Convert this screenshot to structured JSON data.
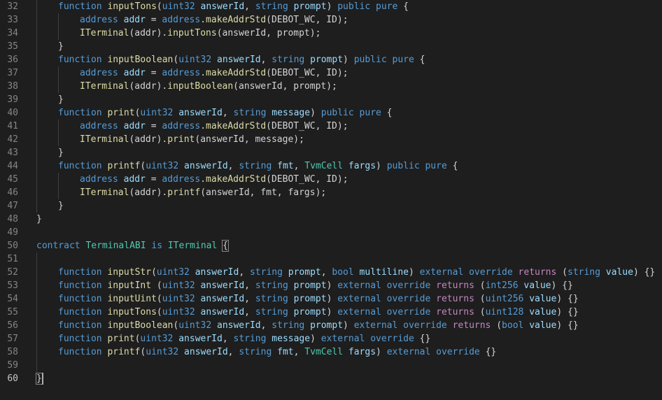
{
  "editor": {
    "lines": [
      {
        "n": "32",
        "indent": 1,
        "tokens": [
          [
            "kw",
            "function "
          ],
          [
            "fn",
            "inputTons"
          ],
          [
            "p",
            "("
          ],
          [
            "ty",
            "uint32"
          ],
          [
            "p",
            " "
          ],
          [
            "id",
            "answerId"
          ],
          [
            "p",
            ", "
          ],
          [
            "ty",
            "string"
          ],
          [
            "p",
            " "
          ],
          [
            "id",
            "prompt"
          ],
          [
            "p",
            ") "
          ],
          [
            "kw",
            "public pure"
          ],
          [
            "p",
            " {"
          ]
        ]
      },
      {
        "n": "33",
        "indent": 2,
        "tokens": [
          [
            "ty",
            "address"
          ],
          [
            "p",
            " "
          ],
          [
            "id",
            "addr"
          ],
          [
            "p",
            " = "
          ],
          [
            "ty",
            "address"
          ],
          [
            "p",
            "."
          ],
          [
            "fn",
            "makeAddrStd"
          ],
          [
            "p",
            "(DEBOT_WC, ID);"
          ]
        ]
      },
      {
        "n": "34",
        "indent": 2,
        "tokens": [
          [
            "fn",
            "ITerminal"
          ],
          [
            "p",
            "(addr)."
          ],
          [
            "fn",
            "inputTons"
          ],
          [
            "p",
            "(answerId, prompt);"
          ]
        ]
      },
      {
        "n": "35",
        "indent": 1,
        "tokens": [
          [
            "p",
            "}"
          ]
        ]
      },
      {
        "n": "36",
        "indent": 1,
        "tokens": [
          [
            "kw",
            "function "
          ],
          [
            "fn",
            "inputBoolean"
          ],
          [
            "p",
            "("
          ],
          [
            "ty",
            "uint32"
          ],
          [
            "p",
            " "
          ],
          [
            "id",
            "answerId"
          ],
          [
            "p",
            ", "
          ],
          [
            "ty",
            "string"
          ],
          [
            "p",
            " "
          ],
          [
            "id",
            "prompt"
          ],
          [
            "p",
            ") "
          ],
          [
            "kw",
            "public pure"
          ],
          [
            "p",
            " {"
          ]
        ]
      },
      {
        "n": "37",
        "indent": 2,
        "tokens": [
          [
            "ty",
            "address"
          ],
          [
            "p",
            " "
          ],
          [
            "id",
            "addr"
          ],
          [
            "p",
            " = "
          ],
          [
            "ty",
            "address"
          ],
          [
            "p",
            "."
          ],
          [
            "fn",
            "makeAddrStd"
          ],
          [
            "p",
            "(DEBOT_WC, ID);"
          ]
        ]
      },
      {
        "n": "38",
        "indent": 2,
        "tokens": [
          [
            "fn",
            "ITerminal"
          ],
          [
            "p",
            "(addr)."
          ],
          [
            "fn",
            "inputBoolean"
          ],
          [
            "p",
            "(answerId, prompt);"
          ]
        ]
      },
      {
        "n": "39",
        "indent": 1,
        "tokens": [
          [
            "p",
            "}"
          ]
        ]
      },
      {
        "n": "40",
        "indent": 1,
        "tokens": [
          [
            "kw",
            "function "
          ],
          [
            "fn",
            "print"
          ],
          [
            "p",
            "("
          ],
          [
            "ty",
            "uint32"
          ],
          [
            "p",
            " "
          ],
          [
            "id",
            "answerId"
          ],
          [
            "p",
            ", "
          ],
          [
            "ty",
            "string"
          ],
          [
            "p",
            " "
          ],
          [
            "id",
            "message"
          ],
          [
            "p",
            ") "
          ],
          [
            "kw",
            "public pure"
          ],
          [
            "p",
            " {"
          ]
        ]
      },
      {
        "n": "41",
        "indent": 2,
        "tokens": [
          [
            "ty",
            "address"
          ],
          [
            "p",
            " "
          ],
          [
            "id",
            "addr"
          ],
          [
            "p",
            " = "
          ],
          [
            "ty",
            "address"
          ],
          [
            "p",
            "."
          ],
          [
            "fn",
            "makeAddrStd"
          ],
          [
            "p",
            "(DEBOT_WC, ID);"
          ]
        ]
      },
      {
        "n": "42",
        "indent": 2,
        "tokens": [
          [
            "fn",
            "ITerminal"
          ],
          [
            "p",
            "(addr)."
          ],
          [
            "fn",
            "print"
          ],
          [
            "p",
            "(answerId, message);"
          ]
        ]
      },
      {
        "n": "43",
        "indent": 1,
        "tokens": [
          [
            "p",
            "}"
          ]
        ]
      },
      {
        "n": "44",
        "indent": 1,
        "tokens": [
          [
            "kw",
            "function "
          ],
          [
            "fn",
            "printf"
          ],
          [
            "p",
            "("
          ],
          [
            "ty",
            "uint32"
          ],
          [
            "p",
            " "
          ],
          [
            "id",
            "answerId"
          ],
          [
            "p",
            ", "
          ],
          [
            "ty",
            "string"
          ],
          [
            "p",
            " "
          ],
          [
            "id",
            "fmt"
          ],
          [
            "p",
            ", "
          ],
          [
            "cls",
            "TvmCell"
          ],
          [
            "p",
            " "
          ],
          [
            "id",
            "fargs"
          ],
          [
            "p",
            ") "
          ],
          [
            "kw",
            "public pure"
          ],
          [
            "p",
            " {"
          ]
        ]
      },
      {
        "n": "45",
        "indent": 2,
        "tokens": [
          [
            "ty",
            "address"
          ],
          [
            "p",
            " "
          ],
          [
            "id",
            "addr"
          ],
          [
            "p",
            " = "
          ],
          [
            "ty",
            "address"
          ],
          [
            "p",
            "."
          ],
          [
            "fn",
            "makeAddrStd"
          ],
          [
            "p",
            "(DEBOT_WC, ID);"
          ]
        ]
      },
      {
        "n": "46",
        "indent": 2,
        "tokens": [
          [
            "fn",
            "ITerminal"
          ],
          [
            "p",
            "(addr)."
          ],
          [
            "fn",
            "printf"
          ],
          [
            "p",
            "(answerId, fmt, fargs);"
          ]
        ]
      },
      {
        "n": "47",
        "indent": 1,
        "tokens": [
          [
            "p",
            "}"
          ]
        ]
      },
      {
        "n": "48",
        "indent": 0,
        "tokens": [
          [
            "p",
            "}"
          ]
        ]
      },
      {
        "n": "49",
        "indent": 0,
        "tokens": []
      },
      {
        "n": "50",
        "indent": 0,
        "tokens": [
          [
            "kw",
            "contract "
          ],
          [
            "cls",
            "TerminalABI"
          ],
          [
            "kw",
            " is "
          ],
          [
            "cls",
            "ITerminal"
          ],
          [
            "p",
            " "
          ],
          [
            "bm",
            "{"
          ]
        ]
      },
      {
        "n": "51",
        "indent": 1,
        "tokens": []
      },
      {
        "n": "52",
        "indent": 1,
        "tokens": [
          [
            "kw",
            "function "
          ],
          [
            "fn",
            "inputStr"
          ],
          [
            "p",
            "("
          ],
          [
            "ty",
            "uint32"
          ],
          [
            "p",
            " "
          ],
          [
            "id",
            "answerId"
          ],
          [
            "p",
            ", "
          ],
          [
            "ty",
            "string"
          ],
          [
            "p",
            " "
          ],
          [
            "id",
            "prompt"
          ],
          [
            "p",
            ", "
          ],
          [
            "ty",
            "bool"
          ],
          [
            "p",
            " "
          ],
          [
            "id",
            "multiline"
          ],
          [
            "p",
            ") "
          ],
          [
            "kw",
            "external override "
          ],
          [
            "ret",
            "returns"
          ],
          [
            "p",
            " ("
          ],
          [
            "ty",
            "string"
          ],
          [
            "p",
            " "
          ],
          [
            "id",
            "value"
          ],
          [
            "p",
            ") {}"
          ]
        ]
      },
      {
        "n": "53",
        "indent": 1,
        "tokens": [
          [
            "kw",
            "function "
          ],
          [
            "fn",
            "inputInt"
          ],
          [
            "p",
            " ("
          ],
          [
            "ty",
            "uint32"
          ],
          [
            "p",
            " "
          ],
          [
            "id",
            "answerId"
          ],
          [
            "p",
            ", "
          ],
          [
            "ty",
            "string"
          ],
          [
            "p",
            " "
          ],
          [
            "id",
            "prompt"
          ],
          [
            "p",
            ") "
          ],
          [
            "kw",
            "external override "
          ],
          [
            "ret",
            "returns"
          ],
          [
            "p",
            " ("
          ],
          [
            "ty",
            "int256"
          ],
          [
            "p",
            " "
          ],
          [
            "id",
            "value"
          ],
          [
            "p",
            ") {}"
          ]
        ]
      },
      {
        "n": "54",
        "indent": 1,
        "tokens": [
          [
            "kw",
            "function "
          ],
          [
            "fn",
            "inputUint"
          ],
          [
            "p",
            "("
          ],
          [
            "ty",
            "uint32"
          ],
          [
            "p",
            " "
          ],
          [
            "id",
            "answerId"
          ],
          [
            "p",
            ", "
          ],
          [
            "ty",
            "string"
          ],
          [
            "p",
            " "
          ],
          [
            "id",
            "prompt"
          ],
          [
            "p",
            ") "
          ],
          [
            "kw",
            "external override "
          ],
          [
            "ret",
            "returns"
          ],
          [
            "p",
            " ("
          ],
          [
            "ty",
            "uint256"
          ],
          [
            "p",
            " "
          ],
          [
            "id",
            "value"
          ],
          [
            "p",
            ") {}"
          ]
        ]
      },
      {
        "n": "55",
        "indent": 1,
        "tokens": [
          [
            "kw",
            "function "
          ],
          [
            "fn",
            "inputTons"
          ],
          [
            "p",
            "("
          ],
          [
            "ty",
            "uint32"
          ],
          [
            "p",
            " "
          ],
          [
            "id",
            "answerId"
          ],
          [
            "p",
            ", "
          ],
          [
            "ty",
            "string"
          ],
          [
            "p",
            " "
          ],
          [
            "id",
            "prompt"
          ],
          [
            "p",
            ") "
          ],
          [
            "kw",
            "external override "
          ],
          [
            "ret",
            "returns"
          ],
          [
            "p",
            " ("
          ],
          [
            "ty",
            "uint128"
          ],
          [
            "p",
            " "
          ],
          [
            "id",
            "value"
          ],
          [
            "p",
            ") {}"
          ]
        ]
      },
      {
        "n": "56",
        "indent": 1,
        "tokens": [
          [
            "kw",
            "function "
          ],
          [
            "fn",
            "inputBoolean"
          ],
          [
            "p",
            "("
          ],
          [
            "ty",
            "uint32"
          ],
          [
            "p",
            " "
          ],
          [
            "id",
            "answerId"
          ],
          [
            "p",
            ", "
          ],
          [
            "ty",
            "string"
          ],
          [
            "p",
            " "
          ],
          [
            "id",
            "prompt"
          ],
          [
            "p",
            ") "
          ],
          [
            "kw",
            "external override "
          ],
          [
            "ret",
            "returns"
          ],
          [
            "p",
            " ("
          ],
          [
            "ty",
            "bool"
          ],
          [
            "p",
            " "
          ],
          [
            "id",
            "value"
          ],
          [
            "p",
            ") {}"
          ]
        ]
      },
      {
        "n": "57",
        "indent": 1,
        "tokens": [
          [
            "kw",
            "function "
          ],
          [
            "fn",
            "print"
          ],
          [
            "p",
            "("
          ],
          [
            "ty",
            "uint32"
          ],
          [
            "p",
            " "
          ],
          [
            "id",
            "answerId"
          ],
          [
            "p",
            ", "
          ],
          [
            "ty",
            "string"
          ],
          [
            "p",
            " "
          ],
          [
            "id",
            "message"
          ],
          [
            "p",
            ") "
          ],
          [
            "kw",
            "external override"
          ],
          [
            "p",
            " {}"
          ]
        ]
      },
      {
        "n": "58",
        "indent": 1,
        "tokens": [
          [
            "kw",
            "function "
          ],
          [
            "fn",
            "printf"
          ],
          [
            "p",
            "("
          ],
          [
            "ty",
            "uint32"
          ],
          [
            "p",
            " "
          ],
          [
            "id",
            "answerId"
          ],
          [
            "p",
            ", "
          ],
          [
            "ty",
            "string"
          ],
          [
            "p",
            " "
          ],
          [
            "id",
            "fmt"
          ],
          [
            "p",
            ", "
          ],
          [
            "cls",
            "TvmCell"
          ],
          [
            "p",
            " "
          ],
          [
            "id",
            "fargs"
          ],
          [
            "p",
            ") "
          ],
          [
            "kw",
            "external override"
          ],
          [
            "p",
            " {}"
          ]
        ]
      },
      {
        "n": "59",
        "indent": 1,
        "tokens": []
      },
      {
        "n": "60",
        "indent": 0,
        "active": true,
        "tokens": [
          [
            "bm",
            "}"
          ]
        ]
      }
    ],
    "colors": {
      "background": "#1e1e1e",
      "keyword": "#569cd6",
      "function": "#dcdcaa",
      "class": "#4ec9b0",
      "identifier": "#9cdcfe",
      "control": "#c586c0",
      "plain": "#d4d4d4",
      "line_number": "#858585"
    }
  }
}
